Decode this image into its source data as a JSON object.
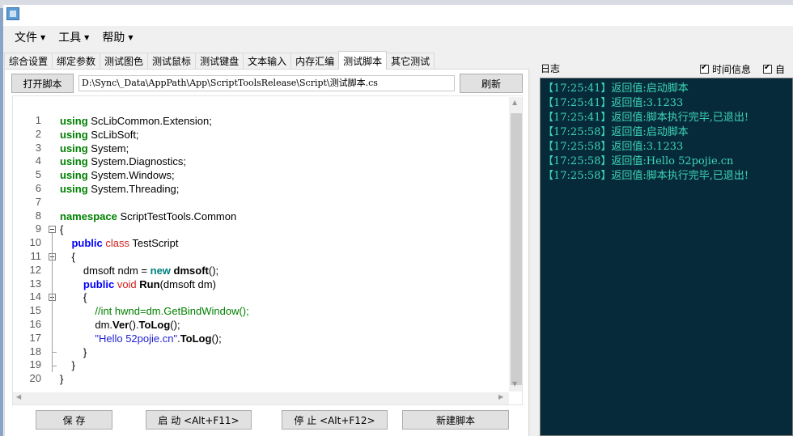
{
  "menu": [
    {
      "label": "文件"
    },
    {
      "label": "工具"
    },
    {
      "label": "帮助"
    }
  ],
  "tabs": [
    "综合设置",
    "绑定参数",
    "测试图色",
    "测试鼠标",
    "测试键盘",
    "文本输入",
    "内存汇编",
    "测试脚本",
    "其它测试"
  ],
  "active_tab": "测试脚本",
  "toolbar": {
    "open_label": "打开脚本",
    "path_value": "D:\\Sync\\_Data\\AppPath\\App\\ScriptToolsRelease\\Script\\测试脚本.cs",
    "refresh_label": "刷新"
  },
  "code": {
    "line_numbers": [
      "1",
      "2",
      "3",
      "4",
      "5",
      "6",
      "7",
      "8",
      "9",
      "10",
      "11",
      "12",
      "13",
      "14",
      "15",
      "16",
      "17",
      "18",
      "19",
      "20"
    ],
    "lines": [
      [
        {
          "t": "using",
          "c": "k-green"
        },
        {
          "t": " ScLibCommon.Extension;"
        }
      ],
      [
        {
          "t": "using",
          "c": "k-green"
        },
        {
          "t": " ScLibSoft;"
        }
      ],
      [
        {
          "t": "using",
          "c": "k-green"
        },
        {
          "t": " System;"
        }
      ],
      [
        {
          "t": "using",
          "c": "k-green"
        },
        {
          "t": " System.Diagnostics;"
        }
      ],
      [
        {
          "t": "using",
          "c": "k-green"
        },
        {
          "t": " System.Windows;"
        }
      ],
      [
        {
          "t": "using",
          "c": "k-green"
        },
        {
          "t": " System.Threading;"
        }
      ],
      [],
      [
        {
          "t": "namespace",
          "c": "k-green"
        },
        {
          "t": " ScriptTestTools.Common"
        }
      ],
      [
        {
          "t": "{"
        }
      ],
      [
        {
          "t": "    "
        },
        {
          "t": "public",
          "c": "k-blue"
        },
        {
          "t": " "
        },
        {
          "t": "class",
          "c": "k-red"
        },
        {
          "t": " TestScript"
        }
      ],
      [
        {
          "t": "    {"
        }
      ],
      [
        {
          "t": "        dmsoft ndm = "
        },
        {
          "t": "new",
          "c": "k-teal"
        },
        {
          "t": " "
        },
        {
          "t": "dmsoft",
          "c": "bold"
        },
        {
          "t": "();"
        }
      ],
      [
        {
          "t": "        "
        },
        {
          "t": "public",
          "c": "k-blue"
        },
        {
          "t": " "
        },
        {
          "t": "void",
          "c": "k-red"
        },
        {
          "t": " "
        },
        {
          "t": "Run",
          "c": "bold"
        },
        {
          "t": "(dmsoft dm)"
        }
      ],
      [
        {
          "t": "        {"
        }
      ],
      [
        {
          "t": "            "
        },
        {
          "t": "//int hwnd=dm.GetBindWindow();",
          "c": "cmt"
        }
      ],
      [
        {
          "t": "            dm."
        },
        {
          "t": "Ver",
          "c": "bold"
        },
        {
          "t": "()."
        },
        {
          "t": "ToLog",
          "c": "bold"
        },
        {
          "t": "();"
        }
      ],
      [
        {
          "t": "            "
        },
        {
          "t": "\"Hello 52pojie.cn\"",
          "c": "str"
        },
        {
          "t": "."
        },
        {
          "t": "ToLog",
          "c": "bold"
        },
        {
          "t": "();"
        }
      ],
      [
        {
          "t": "        }"
        }
      ],
      [
        {
          "t": "    }"
        }
      ],
      [
        {
          "t": "}"
        }
      ]
    ]
  },
  "buttons": {
    "save": "保    存",
    "start": "启    动 <Alt+F11>",
    "stop": "停    止 <Alt+F12>",
    "new_script": "新建脚本"
  },
  "log": {
    "title": "日志",
    "options": [
      {
        "label": "时间信息",
        "checked": true
      },
      {
        "label": "自",
        "checked": true
      }
    ],
    "lines": [
      "【17:25:41】返回值:启动脚本",
      "【17:25:41】返回值:3.1233",
      "【17:25:41】返回值:脚本执行完毕,已退出!",
      "【17:25:58】返回值:启动脚本",
      "【17:25:58】返回值:3.1233",
      "【17:25:58】返回值:Hello 52pojie.cn",
      "【17:25:58】返回值:脚本执行完毕,已退出!"
    ]
  }
}
